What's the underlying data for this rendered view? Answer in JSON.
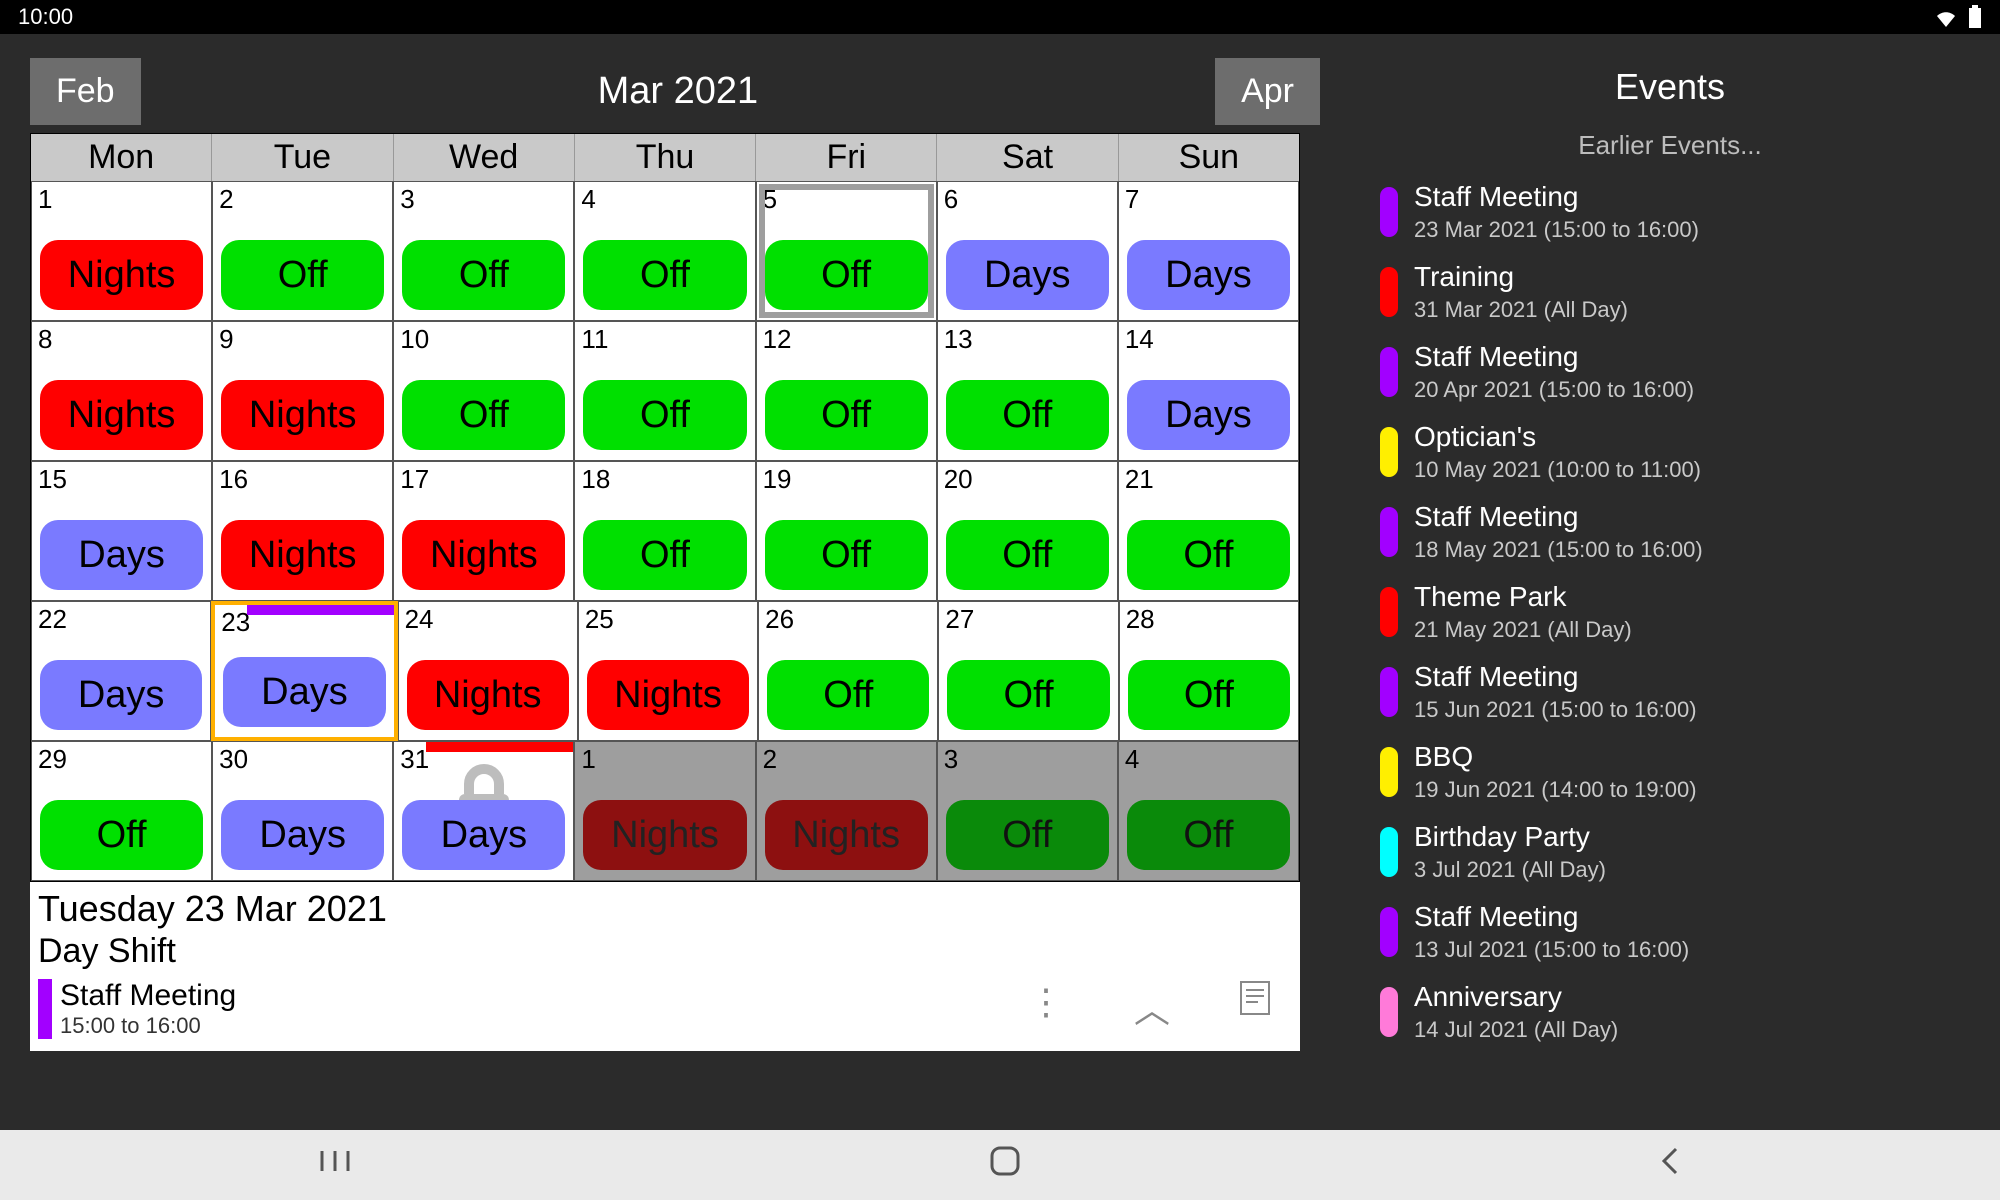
{
  "status": {
    "time": "10:00"
  },
  "nav": {
    "prev": "Feb",
    "title": "Mar 2021",
    "next": "Apr"
  },
  "weekdays": [
    "Mon",
    "Tue",
    "Wed",
    "Thu",
    "Fri",
    "Sat",
    "Sun"
  ],
  "shifts": {
    "nights": "Nights",
    "off": "Off",
    "days": "Days"
  },
  "grid": [
    [
      {
        "d": "1",
        "shift": "nights"
      },
      {
        "d": "2",
        "shift": "off"
      },
      {
        "d": "3",
        "shift": "off"
      },
      {
        "d": "4",
        "shift": "off"
      },
      {
        "d": "5",
        "shift": "off",
        "today": true
      },
      {
        "d": "6",
        "shift": "days"
      },
      {
        "d": "7",
        "shift": "days"
      }
    ],
    [
      {
        "d": "8",
        "shift": "nights"
      },
      {
        "d": "9",
        "shift": "nights"
      },
      {
        "d": "10",
        "shift": "off"
      },
      {
        "d": "11",
        "shift": "off"
      },
      {
        "d": "12",
        "shift": "off"
      },
      {
        "d": "13",
        "shift": "off"
      },
      {
        "d": "14",
        "shift": "days"
      }
    ],
    [
      {
        "d": "15",
        "shift": "days"
      },
      {
        "d": "16",
        "shift": "nights"
      },
      {
        "d": "17",
        "shift": "nights"
      },
      {
        "d": "18",
        "shift": "off"
      },
      {
        "d": "19",
        "shift": "off"
      },
      {
        "d": "20",
        "shift": "off"
      },
      {
        "d": "21",
        "shift": "off"
      }
    ],
    [
      {
        "d": "22",
        "shift": "days"
      },
      {
        "d": "23",
        "shift": "days",
        "selected": true,
        "bar": "purple"
      },
      {
        "d": "24",
        "shift": "nights"
      },
      {
        "d": "25",
        "shift": "nights"
      },
      {
        "d": "26",
        "shift": "off"
      },
      {
        "d": "27",
        "shift": "off"
      },
      {
        "d": "28",
        "shift": "off"
      }
    ],
    [
      {
        "d": "29",
        "shift": "off"
      },
      {
        "d": "30",
        "shift": "days"
      },
      {
        "d": "31",
        "shift": "days",
        "bar": "red",
        "lock": true
      },
      {
        "d": "1",
        "shift": "nights",
        "nextMonth": true
      },
      {
        "d": "2",
        "shift": "nights",
        "nextMonth": true
      },
      {
        "d": "3",
        "shift": "off",
        "nextMonth": true
      },
      {
        "d": "4",
        "shift": "off",
        "nextMonth": true
      }
    ]
  ],
  "detail": {
    "date": "Tuesday 23 Mar 2021",
    "shift": "Day Shift",
    "event": {
      "title": "Staff Meeting",
      "time": "15:00 to 16:00",
      "color": "purple"
    }
  },
  "eventsPane": {
    "title": "Events",
    "earlier": "Earlier Events...",
    "list": [
      {
        "color": "purple",
        "title": "Staff Meeting",
        "sub": "23 Mar 2021 (15:00 to 16:00)"
      },
      {
        "color": "red",
        "title": "Training",
        "sub": "31 Mar 2021 (All Day)"
      },
      {
        "color": "purple",
        "title": "Staff Meeting",
        "sub": "20 Apr 2021 (15:00 to 16:00)"
      },
      {
        "color": "yellow",
        "title": "Optician's",
        "sub": "10 May 2021 (10:00 to 11:00)"
      },
      {
        "color": "purple",
        "title": "Staff Meeting",
        "sub": "18 May 2021 (15:00 to 16:00)"
      },
      {
        "color": "red",
        "title": "Theme Park",
        "sub": "21 May 2021 (All Day)"
      },
      {
        "color": "purple",
        "title": "Staff Meeting",
        "sub": "15 Jun 2021 (15:00 to 16:00)"
      },
      {
        "color": "yellow",
        "title": "BBQ",
        "sub": "19 Jun 2021 (14:00 to 19:00)"
      },
      {
        "color": "cyan",
        "title": "Birthday Party",
        "sub": "3 Jul 2021 (All Day)"
      },
      {
        "color": "purple",
        "title": "Staff Meeting",
        "sub": "13 Jul 2021 (15:00 to 16:00)"
      },
      {
        "color": "pink",
        "title": "Anniversary",
        "sub": "14 Jul 2021 (All Day)"
      }
    ]
  },
  "shiftColors": {
    "nights": "red",
    "off": "green",
    "days": "blue"
  }
}
